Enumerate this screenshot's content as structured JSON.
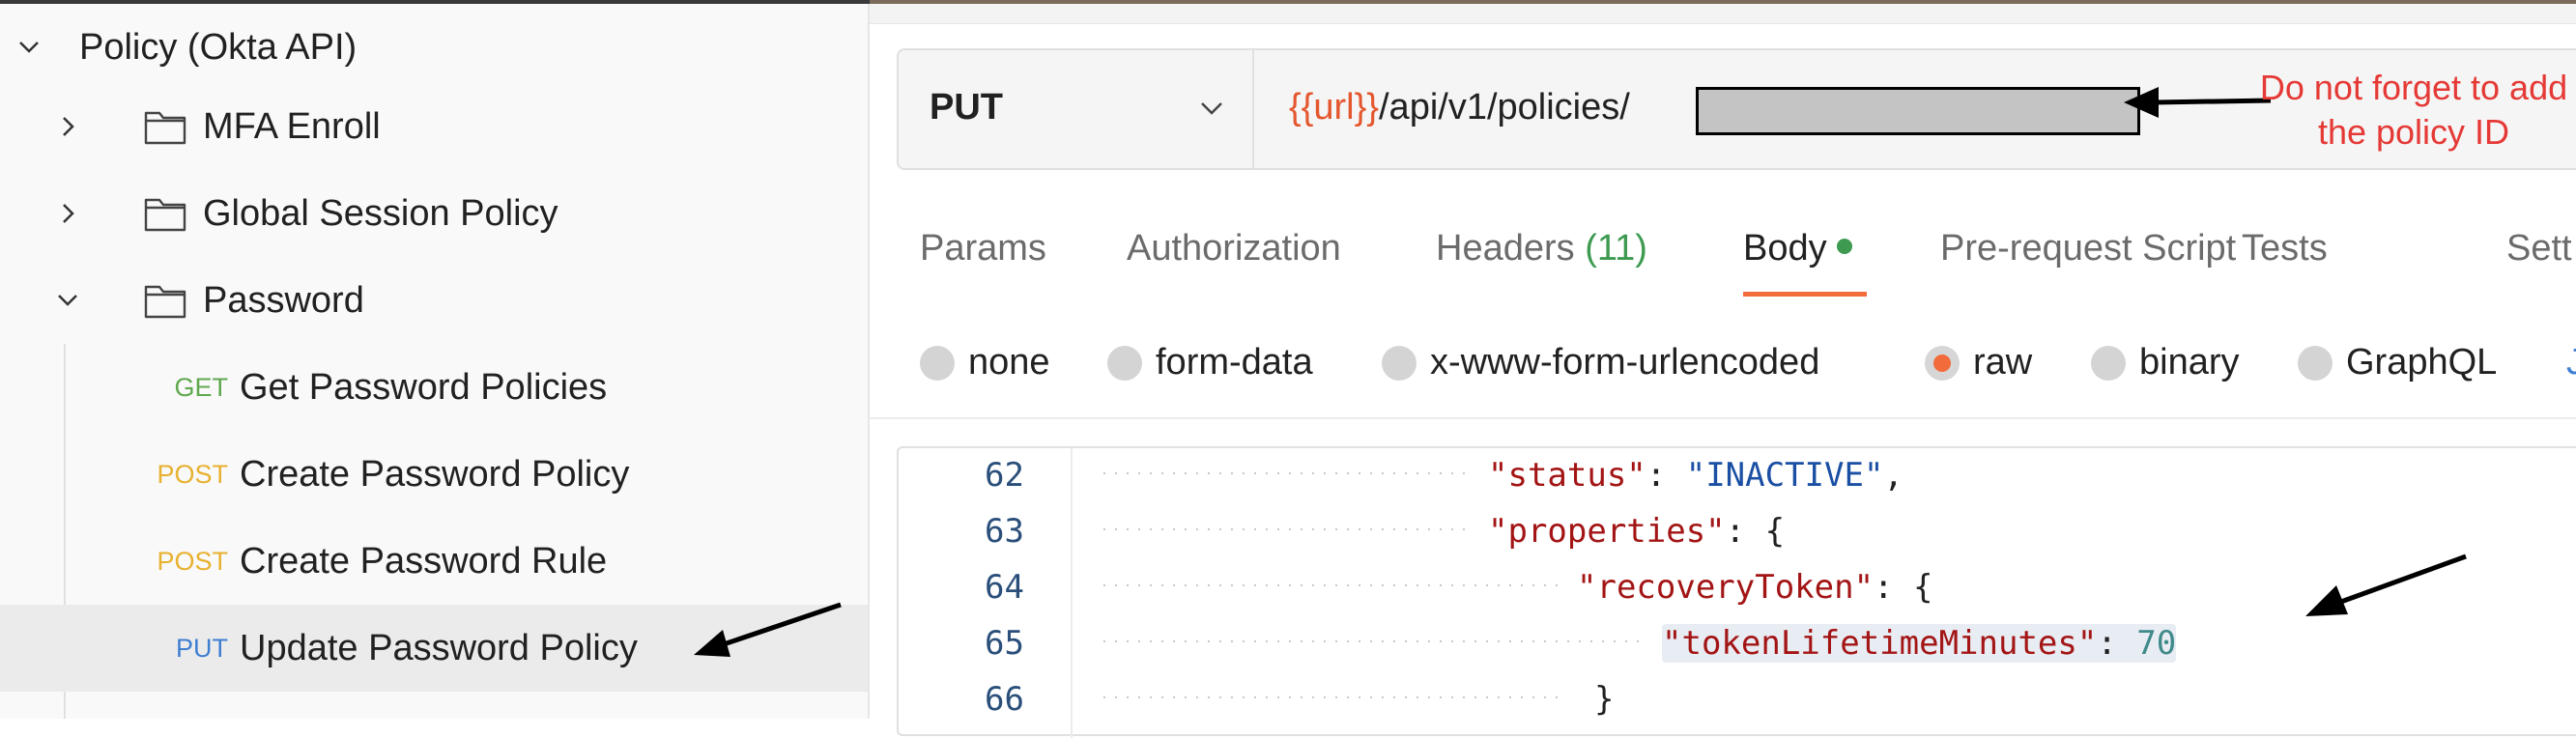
{
  "sidebar": {
    "collection": {
      "label": "Policy (Okta API)"
    },
    "folders": [
      {
        "label": "MFA Enroll"
      },
      {
        "label": "Global Session Policy"
      },
      {
        "label": "Password"
      }
    ],
    "requests": [
      {
        "method": "GET",
        "label": "Get Password Policies"
      },
      {
        "method": "POST",
        "label": "Create Password Policy"
      },
      {
        "method": "POST",
        "label": "Create Password Rule"
      },
      {
        "method": "PUT",
        "label": "Update Password Policy"
      }
    ]
  },
  "request": {
    "method": "PUT",
    "url_var": "{{url}}",
    "url_path": "/api/v1/policies/",
    "annotation_line1": "Do not forget to add",
    "annotation_line2": "the policy ID"
  },
  "tabs": {
    "params": "Params",
    "authorization": "Authorization",
    "headers": "Headers",
    "headers_count": "(11)",
    "body": "Body",
    "prerequest": "Pre-request Script",
    "tests": "Tests",
    "settings": "Sett"
  },
  "body_types": {
    "none": "none",
    "form_data": "form-data",
    "urlencoded": "x-www-form-urlencoded",
    "raw": "raw",
    "binary": "binary",
    "graphql": "GraphQL",
    "format": "J"
  },
  "selected_body_type": "raw",
  "code": {
    "lines": [
      {
        "num": "62",
        "key": "\"status\"",
        "sep": ": ",
        "val": "\"INACTIVE\"",
        "tail": ","
      },
      {
        "num": "63",
        "key": "\"properties\"",
        "sep": ": ",
        "val": "",
        "tail": "{"
      },
      {
        "num": "64",
        "key": "\"recoveryToken\"",
        "sep": ": ",
        "val": "",
        "tail": "{"
      },
      {
        "num": "65",
        "key": "\"tokenLifetimeMinutes\"",
        "sep": ": ",
        "val": "70",
        "tail": ""
      },
      {
        "num": "66",
        "key": "",
        "sep": "",
        "val": "",
        "tail": "}"
      }
    ]
  },
  "colors": {
    "accent": "#f26b3a",
    "annotation": "#e53935",
    "get": "#5fa84f",
    "post": "#e8b12f",
    "put": "#3f7fd1"
  }
}
